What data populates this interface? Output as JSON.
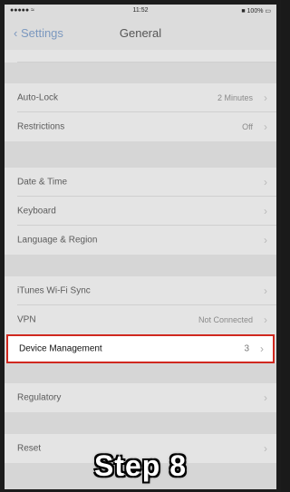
{
  "status_bar": {
    "carrier": "●●●●● ≈",
    "time": "11:52",
    "battery": "■ 100% ▭"
  },
  "nav": {
    "back_label": "‹ Settings",
    "title": "General"
  },
  "rows": {
    "auto_lock": {
      "label": "Auto-Lock",
      "value": "2 Minutes"
    },
    "restrictions": {
      "label": "Restrictions",
      "value": "Off"
    },
    "date_time": {
      "label": "Date & Time"
    },
    "keyboard": {
      "label": "Keyboard"
    },
    "language_region": {
      "label": "Language & Region"
    },
    "itunes_sync": {
      "label": "iTunes Wi-Fi Sync"
    },
    "vpn": {
      "label": "VPN",
      "value": "Not Connected"
    },
    "device_management": {
      "label": "Device Management",
      "value": "3"
    },
    "regulatory": {
      "label": "Regulatory"
    },
    "reset": {
      "label": "Reset"
    }
  },
  "chevron": "›",
  "caption": "Step  8",
  "colors": {
    "highlight_border": "#d0281f",
    "overlay": "#dcdcdc"
  }
}
